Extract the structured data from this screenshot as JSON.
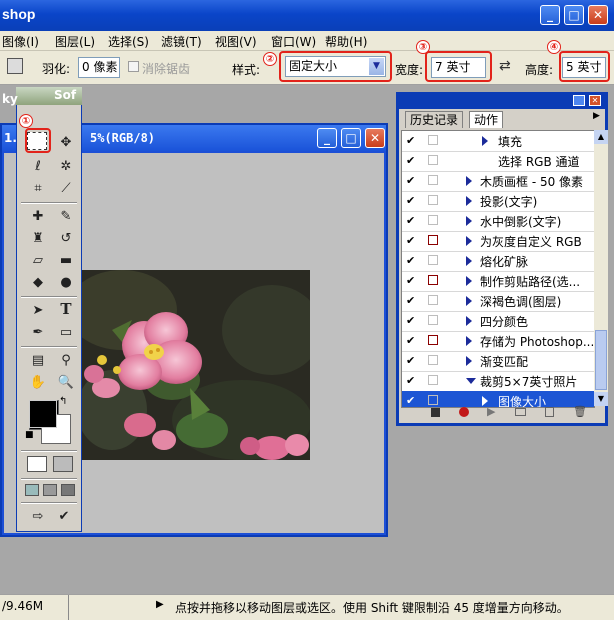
{
  "app": {
    "title": "shop"
  },
  "menu": [
    "图像(I)",
    "图层(L)",
    "选择(S)",
    "滤镜(T)",
    "视图(V)",
    "窗口(W)",
    "帮助(H)"
  ],
  "options": {
    "feather_label": "羽化:",
    "feather_value": "0 像素",
    "antialias_label": "消除锯齿",
    "style_label": "样式:",
    "style_value": "固定大小",
    "width_label": "宽度:",
    "width_value": "7 英寸",
    "height_label": "高度:",
    "height_value": "5 英寸",
    "callouts": [
      "②",
      "③",
      "④"
    ]
  },
  "toolbox": {
    "brand": "Sof",
    "brand2": "ky",
    "callout": "①"
  },
  "document": {
    "title_left": "1.",
    "title_right": "5%(RGB/8)"
  },
  "panel": {
    "tab_history": "历史记录",
    "tab_actions": "动作",
    "items": [
      {
        "label": "填充",
        "level": 2,
        "dialog": false,
        "tri": "right"
      },
      {
        "label": "选择 RGB 通道",
        "level": 2,
        "dialog": false,
        "tri": "none"
      },
      {
        "label": "木质画框 - 50 像素",
        "level": 1,
        "dialog": false,
        "tri": "right"
      },
      {
        "label": "投影(文字)",
        "level": 1,
        "dialog": false,
        "tri": "right"
      },
      {
        "label": "水中倒影(文字)",
        "level": 1,
        "dialog": false,
        "tri": "right"
      },
      {
        "label": "为灰度自定义 RGB",
        "level": 1,
        "dialog": true,
        "tri": "right"
      },
      {
        "label": "熔化矿脉",
        "level": 1,
        "dialog": false,
        "tri": "right"
      },
      {
        "label": "制作剪贴路径(选...",
        "level": 1,
        "dialog": true,
        "tri": "right"
      },
      {
        "label": "深褐色调(图层)",
        "level": 1,
        "dialog": false,
        "tri": "right"
      },
      {
        "label": "四分颜色",
        "level": 1,
        "dialog": false,
        "tri": "right"
      },
      {
        "label": "存储为 Photoshop...",
        "level": 1,
        "dialog": true,
        "tri": "right"
      },
      {
        "label": "渐变匹配",
        "level": 1,
        "dialog": false,
        "tri": "right"
      },
      {
        "label": "裁剪5×7英寸照片",
        "level": 1,
        "dialog": false,
        "tri": "down"
      },
      {
        "label": "图像大小",
        "level": 2,
        "dialog": false,
        "tri": "right",
        "selected": true
      }
    ]
  },
  "status": {
    "doc_size": "/9.46M",
    "message": "点按并拖移以移动图层或选区。使用 Shift 键限制沿 45 度增量方向移动。"
  }
}
